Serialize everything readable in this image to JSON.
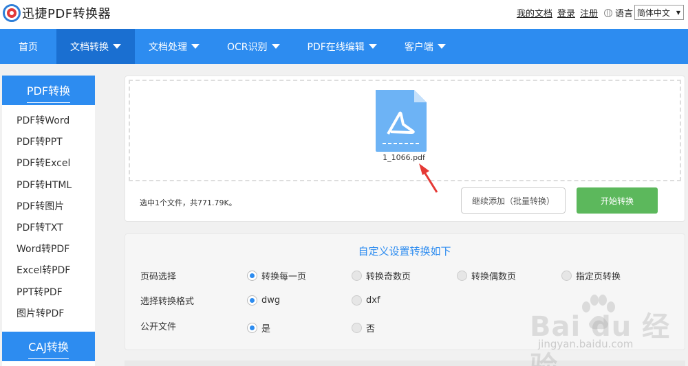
{
  "header": {
    "logo_text": "迅捷PDF转换器",
    "links": [
      "我的文档",
      "登录",
      "注册"
    ],
    "lang_label": "语言",
    "lang_selected": "简体中文"
  },
  "nav": {
    "items": [
      {
        "label": "首页",
        "dropdown": false,
        "active": false
      },
      {
        "label": "文档转换",
        "dropdown": true,
        "active": true
      },
      {
        "label": "文档处理",
        "dropdown": true,
        "active": false
      },
      {
        "label": "OCR识别",
        "dropdown": true,
        "active": false
      },
      {
        "label": "PDF在线编辑",
        "dropdown": true,
        "active": false
      },
      {
        "label": "客户端",
        "dropdown": true,
        "active": false
      }
    ]
  },
  "sidebar": {
    "section_title": "PDF转换",
    "items": [
      "PDF转Word",
      "PDF转PPT",
      "PDF转Excel",
      "PDF转HTML",
      "PDF转图片",
      "PDF转TXT",
      "Word转PDF",
      "Excel转PDF",
      "PPT转PDF",
      "图片转PDF"
    ],
    "next_section_title": "CAJ转换"
  },
  "upload": {
    "file_name": "1_1066.pdf",
    "status": "选中1个文件，共771.79K。",
    "continue_label": "继续添加（批量转换）",
    "start_label": "开始转换"
  },
  "settings": {
    "title": "自定义设置转换如下",
    "rows": [
      {
        "label": "页码选择",
        "options": [
          "转换每一页",
          "转换奇数页",
          "转换偶数页",
          "指定页转换"
        ],
        "selected": 0
      },
      {
        "label": "选择转换格式",
        "options": [
          "dwg",
          "dxf"
        ],
        "selected": 0
      },
      {
        "label": "公开文件",
        "options": [
          "是",
          "否"
        ],
        "selected": 0
      }
    ]
  },
  "watermark": {
    "text": "Bai du 经验",
    "sub": "jingyan.baidu.com"
  },
  "colors": {
    "primary": "#2d8cf0",
    "nav_active": "#1a6fd1",
    "start_button": "#5cb85c",
    "annotation_arrow": "#e53935"
  }
}
